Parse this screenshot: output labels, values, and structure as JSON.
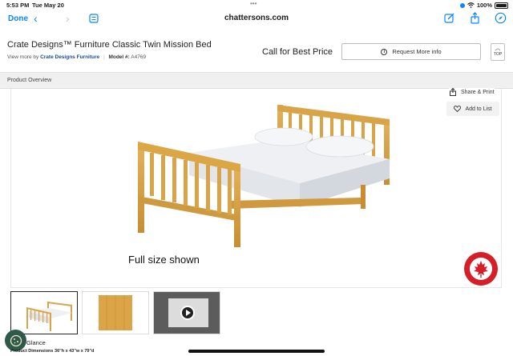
{
  "status_bar": {
    "time": "5:53 PM",
    "date": "Tue May 20",
    "battery": "100%"
  },
  "browser": {
    "done_label": "Done",
    "url": "chattersons.com",
    "accent_color": "#0a84ff"
  },
  "product": {
    "title": "Crate Designs™ Furniture Classic Twin Mission Bed",
    "view_more_prefix": "View more by",
    "brand": "Crate Designs Furniture",
    "model_label": "Model #:",
    "model_number": "A4769",
    "price_text": "Call for Best Price",
    "request_label": "Request More info",
    "top_label": "TOP"
  },
  "section": {
    "overview_label": "Product Overview"
  },
  "image": {
    "caption": "Full size shown",
    "badge_text": "MADE IN CANADA"
  },
  "actions": {
    "share_label": "Share & Print",
    "add_list_label": "Add to List"
  },
  "thumbnails": [
    {
      "kind": "bed-photo",
      "active": true
    },
    {
      "kind": "wood-swatch",
      "active": false
    },
    {
      "kind": "video",
      "active": false
    }
  ],
  "details": {
    "glance_label": "Glance",
    "dimensions_label": "Product Dimensions",
    "dimensions_value": "36\"h x 43\"w x 79\"d"
  }
}
